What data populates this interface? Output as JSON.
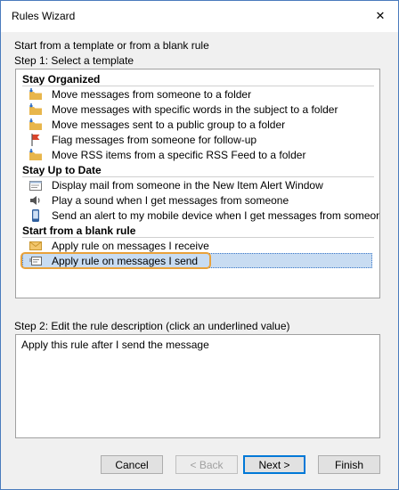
{
  "window": {
    "title": "Rules Wizard",
    "close_glyph": "✕"
  },
  "intro_text": "Start from a template or from a blank rule",
  "step1": {
    "label": "Step 1: Select a template",
    "groups": [
      {
        "header": "Stay Organized",
        "items": [
          {
            "label": "Move messages from someone to a folder",
            "icon": "folder-arrow-icon"
          },
          {
            "label": "Move messages with specific words in the subject to a folder",
            "icon": "folder-arrow-icon"
          },
          {
            "label": "Move messages sent to a public group to a folder",
            "icon": "folder-arrow-icon"
          },
          {
            "label": "Flag messages from someone for follow-up",
            "icon": "flag-icon"
          },
          {
            "label": "Move RSS items from a specific RSS Feed to a folder",
            "icon": "folder-arrow-icon"
          }
        ]
      },
      {
        "header": "Stay Up to Date",
        "items": [
          {
            "label": "Display mail from someone in the New Item Alert Window",
            "icon": "alert-window-icon"
          },
          {
            "label": "Play a sound when I get messages from someone",
            "icon": "speaker-icon"
          },
          {
            "label": "Send an alert to my mobile device when I get messages from someone",
            "icon": "mobile-phone-icon"
          }
        ]
      },
      {
        "header": "Start from a blank rule",
        "items": [
          {
            "label": "Apply rule on messages I receive",
            "icon": "envelope-icon"
          },
          {
            "label": "Apply rule on messages I send",
            "icon": "send-message-icon",
            "selected": true
          }
        ]
      }
    ]
  },
  "step2": {
    "label": "Step 2: Edit the rule description (click an underlined value)",
    "description": "Apply this rule after I send the message"
  },
  "buttons": {
    "cancel": "Cancel",
    "back": "< Back",
    "next": "Next >",
    "finish": "Finish"
  },
  "colors": {
    "selection": "#c8dcf2",
    "highlight_ring": "#e9a23b",
    "folder": "#e8b64c",
    "flag": "#d9442b",
    "arrow": "#2b6cc4"
  }
}
